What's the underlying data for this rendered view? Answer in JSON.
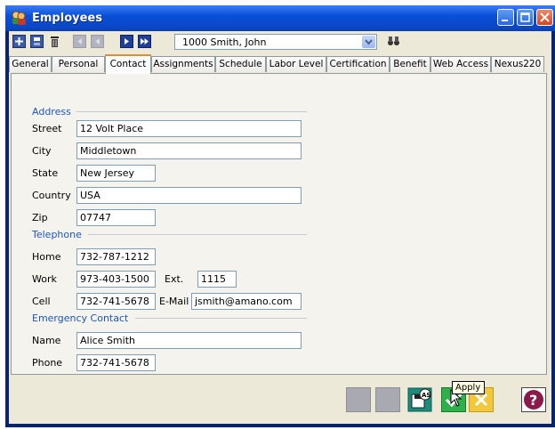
{
  "window": {
    "title": "Employees"
  },
  "toolbar": {
    "employee_selector": "1000 Smith, John"
  },
  "tabs": [
    {
      "label": "General"
    },
    {
      "label": "Personal"
    },
    {
      "label": "Contact"
    },
    {
      "label": "Assignments"
    },
    {
      "label": "Schedule"
    },
    {
      "label": "Labor Level"
    },
    {
      "label": "Certification"
    },
    {
      "label": "Benefit"
    },
    {
      "label": "Web Access"
    },
    {
      "label": "Nexus220"
    }
  ],
  "active_tab": "Contact",
  "address": {
    "section_label": "Address",
    "street_label": "Street",
    "street_value": "12 Volt Place",
    "city_label": "City",
    "city_value": "Middletown",
    "state_label": "State",
    "state_value": "New Jersey",
    "country_label": "Country",
    "country_value": "USA",
    "zip_label": "Zip",
    "zip_value": "07747"
  },
  "telephone": {
    "section_label": "Telephone",
    "home_label": "Home",
    "home_value": "732-787-1212",
    "work_label": "Work",
    "work_value": "973-403-1500",
    "ext_label": "Ext.",
    "ext_value": "1115",
    "cell_label": "Cell",
    "cell_value": "732-741-5678",
    "email_label": "E-Mail",
    "email_value": "jsmith@amano.com"
  },
  "emergency": {
    "section_label": "Emergency Contact",
    "name_label": "Name",
    "name_value": "Alice Smith",
    "phone_label": "Phone",
    "phone_value": "732-741-5678"
  },
  "tooltip": "Apply",
  "colors": {
    "title_bar": "#0a4fd9",
    "section_text": "#1d56c8",
    "active_tab_accent": "#e68b2c"
  }
}
